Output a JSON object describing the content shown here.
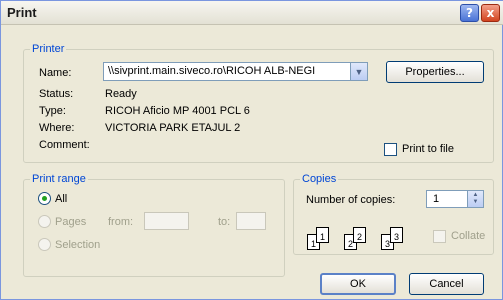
{
  "window": {
    "title": "Print",
    "help_icon": "?",
    "close_icon": "x"
  },
  "printer": {
    "legend": "Printer",
    "name_label": "Name:",
    "name_value": "\\\\sivprint.main.siveco.ro\\RICOH ALB-NEGI",
    "properties_button": "Properties...",
    "status_label": "Status:",
    "status_value": "Ready",
    "type_label": "Type:",
    "type_value": "RICOH Aficio MP 4001 PCL 6",
    "where_label": "Where:",
    "where_value": "VICTORIA PARK ETAJUL 2",
    "comment_label": "Comment:",
    "print_to_file_label": "Print to file",
    "print_to_file_checked": false
  },
  "print_range": {
    "legend": "Print range",
    "all_label": "All",
    "pages_label": "Pages",
    "from_label": "from:",
    "to_label": "to:",
    "selection_label": "Selection",
    "selected": "All"
  },
  "copies": {
    "legend": "Copies",
    "number_label": "Number of copies:",
    "number_value": "1",
    "collate_label": "Collate",
    "collate_checked": false,
    "page_labels": [
      "1",
      "1",
      "2",
      "2",
      "3",
      "3"
    ]
  },
  "buttons": {
    "ok": "OK",
    "cancel": "Cancel"
  },
  "colors": {
    "accent": "#0046d5",
    "title_bar": "#e3e1d4",
    "dialog_bg": "#ece9d8"
  }
}
